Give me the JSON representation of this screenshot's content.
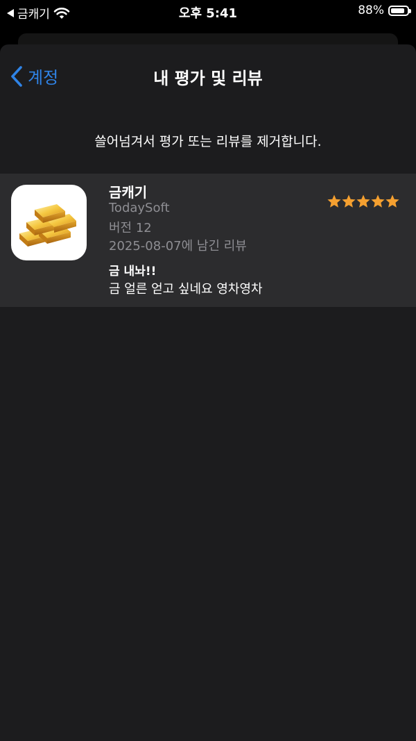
{
  "status_bar": {
    "back_app": "금캐기",
    "time": "오후 5:41",
    "battery": "88%",
    "battery_level": 0.88
  },
  "nav": {
    "back_label": "계정",
    "title": "내 평가 및 리뷰"
  },
  "hint": "쓸어넘겨서 평가 또는 리뷰를 제거합니다.",
  "review": {
    "app_name": "금캐기",
    "developer": "TodaySoft",
    "version": "버전 12",
    "date": "2025-08-07에 남긴 리뷰",
    "rating": 5,
    "rating_max": 5,
    "title": "금 내놔!!",
    "body": "금 얼른 얻고 싶네요 영차영차"
  },
  "colors": {
    "accent": "#2f83e6",
    "star": "#f5a030",
    "sheet_bg": "#1c1c1e",
    "row_bg": "#2c2c2e",
    "secondary_text": "#8e8e93"
  },
  "icons": {
    "status_back": "back-triangle-icon",
    "wifi": "wifi-icon",
    "battery": "battery-icon",
    "nav_back": "chevron-left-icon",
    "app": "gold-bars-icon",
    "star": "star-icon"
  }
}
